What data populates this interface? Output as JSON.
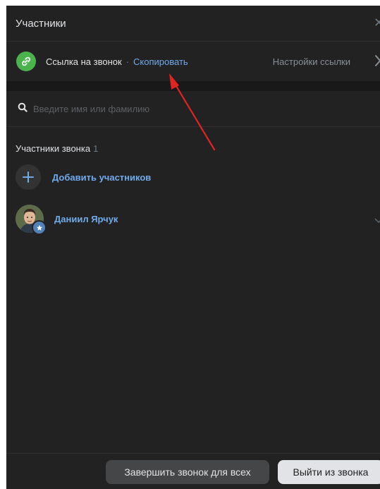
{
  "header": {
    "title": "Участники",
    "close_icon": "close-icon"
  },
  "link_row": {
    "label": "Ссылка на звонок",
    "separator": "·",
    "copy_label": "Скопировать",
    "settings_label": "Настройки ссылки",
    "badge_color": "#4bb34b"
  },
  "search": {
    "placeholder": "Введите имя или фамилию",
    "value": ""
  },
  "participants_section": {
    "title": "Участники звонка",
    "count": "1"
  },
  "add_participants": {
    "label": "Добавить участников"
  },
  "participants": [
    {
      "name": "Даниил Ярчук"
    }
  ],
  "footer": {
    "end_for_all_label": "Завершить звонок для всех",
    "leave_label": "Выйти из звонка"
  },
  "colors": {
    "panel_bg": "#222222",
    "accent_blue": "#71aaeb",
    "annotation_arrow": "#e02424"
  }
}
